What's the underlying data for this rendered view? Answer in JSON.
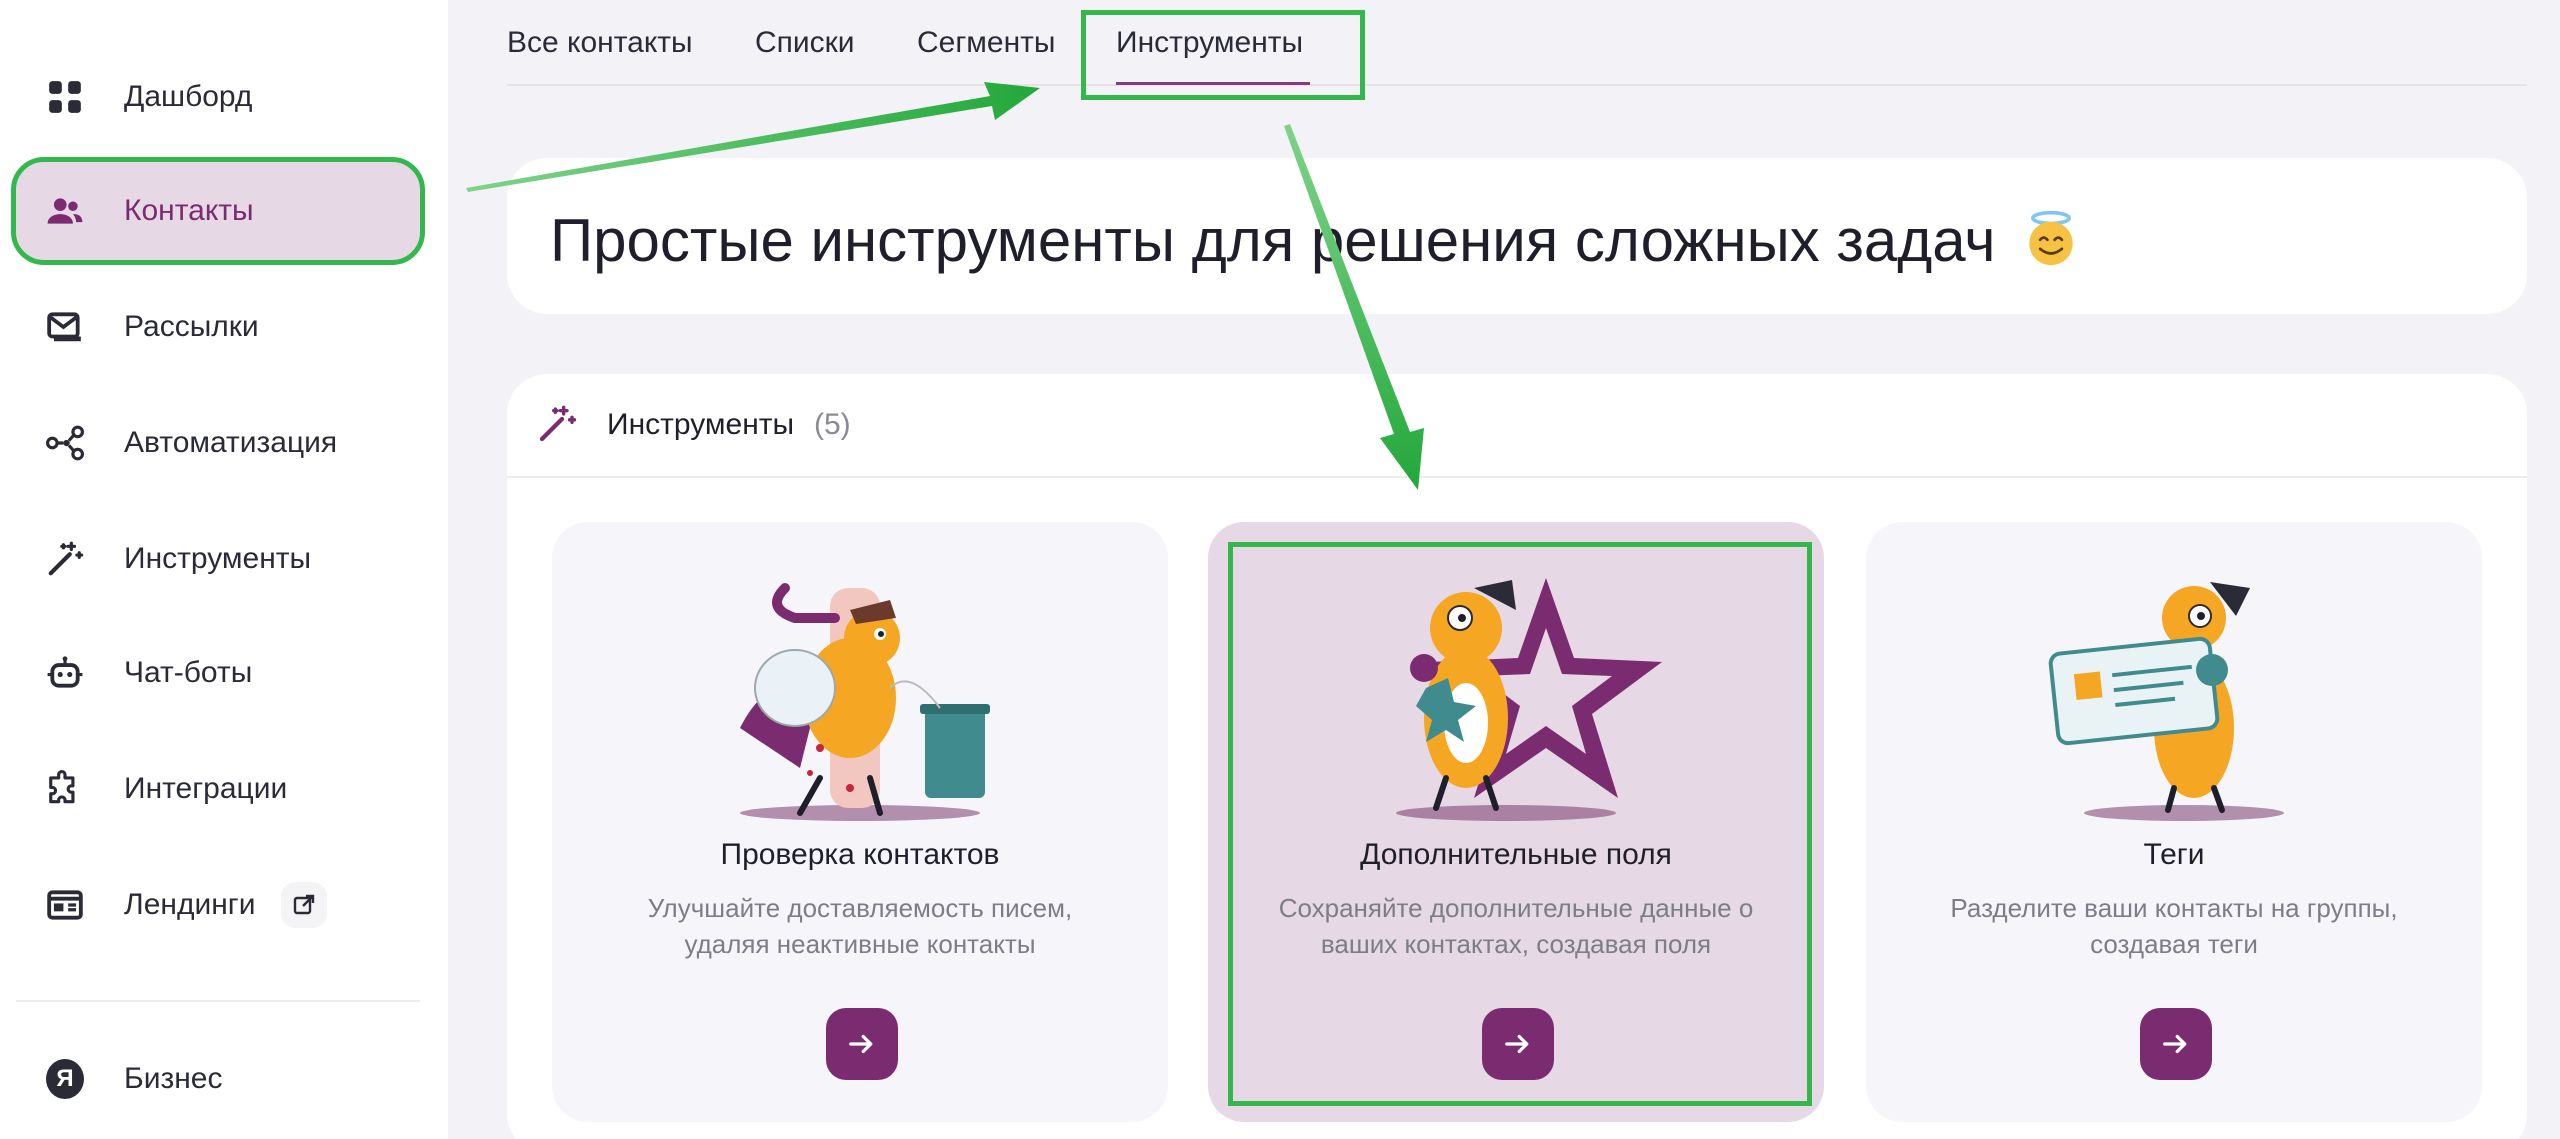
{
  "sidebar": {
    "items": [
      {
        "label": "Дашборд",
        "icon": "dashboard-icon"
      },
      {
        "label": "Контакты",
        "icon": "contacts-icon",
        "active": true
      },
      {
        "label": "Рассылки",
        "icon": "mail-icon"
      },
      {
        "label": "Автоматизация",
        "icon": "automation-icon"
      },
      {
        "label": "Инструменты",
        "icon": "wand-icon"
      },
      {
        "label": "Чат-боты",
        "icon": "bot-icon"
      },
      {
        "label": "Интеграции",
        "icon": "puzzle-icon"
      },
      {
        "label": "Лендинги",
        "icon": "landing-icon",
        "external": "external-link-icon"
      }
    ],
    "footer": {
      "label": "Бизнес",
      "logo_letter": "Я"
    }
  },
  "tabs": [
    {
      "label": "Все контакты"
    },
    {
      "label": "Списки"
    },
    {
      "label": "Сегменты"
    },
    {
      "label": "Инструменты",
      "active": true
    }
  ],
  "hero": {
    "title": "Простые инструменты для решения сложных задач",
    "emoji": "smiling-face-with-halo"
  },
  "panel": {
    "title": "Инструменты",
    "count": "(5)",
    "cards": [
      {
        "title": "Проверка контактов",
        "desc_line1": "Улучшайте доставляемость писем,",
        "desc_line2": "удаляя неактивные контакты",
        "image": "dog-cleaning-illustration"
      },
      {
        "title": "Дополнительные поля",
        "desc_line1": "Сохраняйте дополнительные данные о",
        "desc_line2": "ваших контактах, создавая поля",
        "image": "dog-with-star-illustration",
        "highlighted": true
      },
      {
        "title": "Теги",
        "desc_line1": "Разделите ваши контакты на группы,",
        "desc_line2": "создавая теги",
        "image": "dog-with-badge-illustration"
      }
    ]
  },
  "colors": {
    "accent": "#7b2b6f",
    "active_bg": "#e6d8e5",
    "annotation_green": "#34b84d",
    "page_bg": "#f3f3f7"
  }
}
